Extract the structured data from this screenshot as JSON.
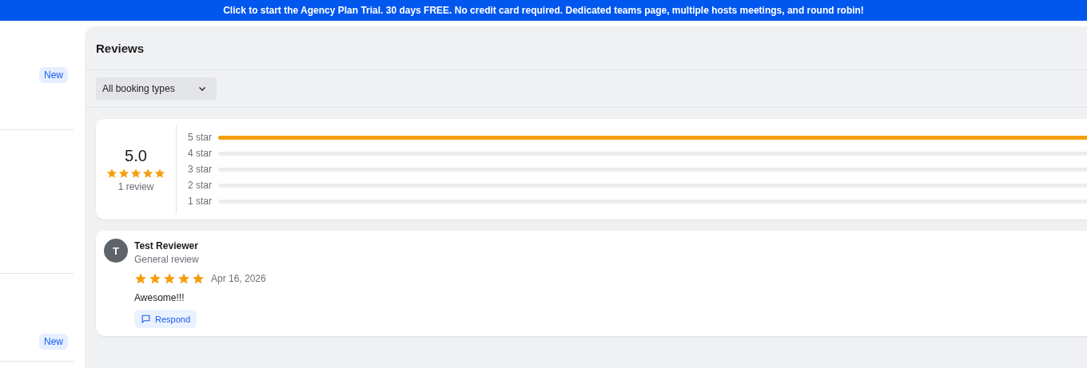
{
  "banner": {
    "text": "Click to start the Agency Plan Trial. 30 days FREE. No credit card required. Dedicated teams page, multiple hosts meetings, and round robin!"
  },
  "sidebar": {
    "badges": [
      "New",
      "New"
    ]
  },
  "page": {
    "title": "Reviews",
    "filter": {
      "value": "All booking types"
    }
  },
  "summary": {
    "average": "5.0",
    "stars": 5,
    "count": "1 review",
    "distribution": [
      {
        "label": "5 star",
        "level": 1
      },
      {
        "label": "4 star"
      },
      {
        "label": "3 star"
      },
      {
        "label": "2 star"
      },
      {
        "label": "1 star"
      }
    ]
  },
  "reviews": [
    {
      "initial": "T",
      "name": "Test Reviewer",
      "type": "General review",
      "stars": 5,
      "date": "Apr 16, 2026",
      "text": "Awesome!!!",
      "action": "Respond"
    }
  ]
}
